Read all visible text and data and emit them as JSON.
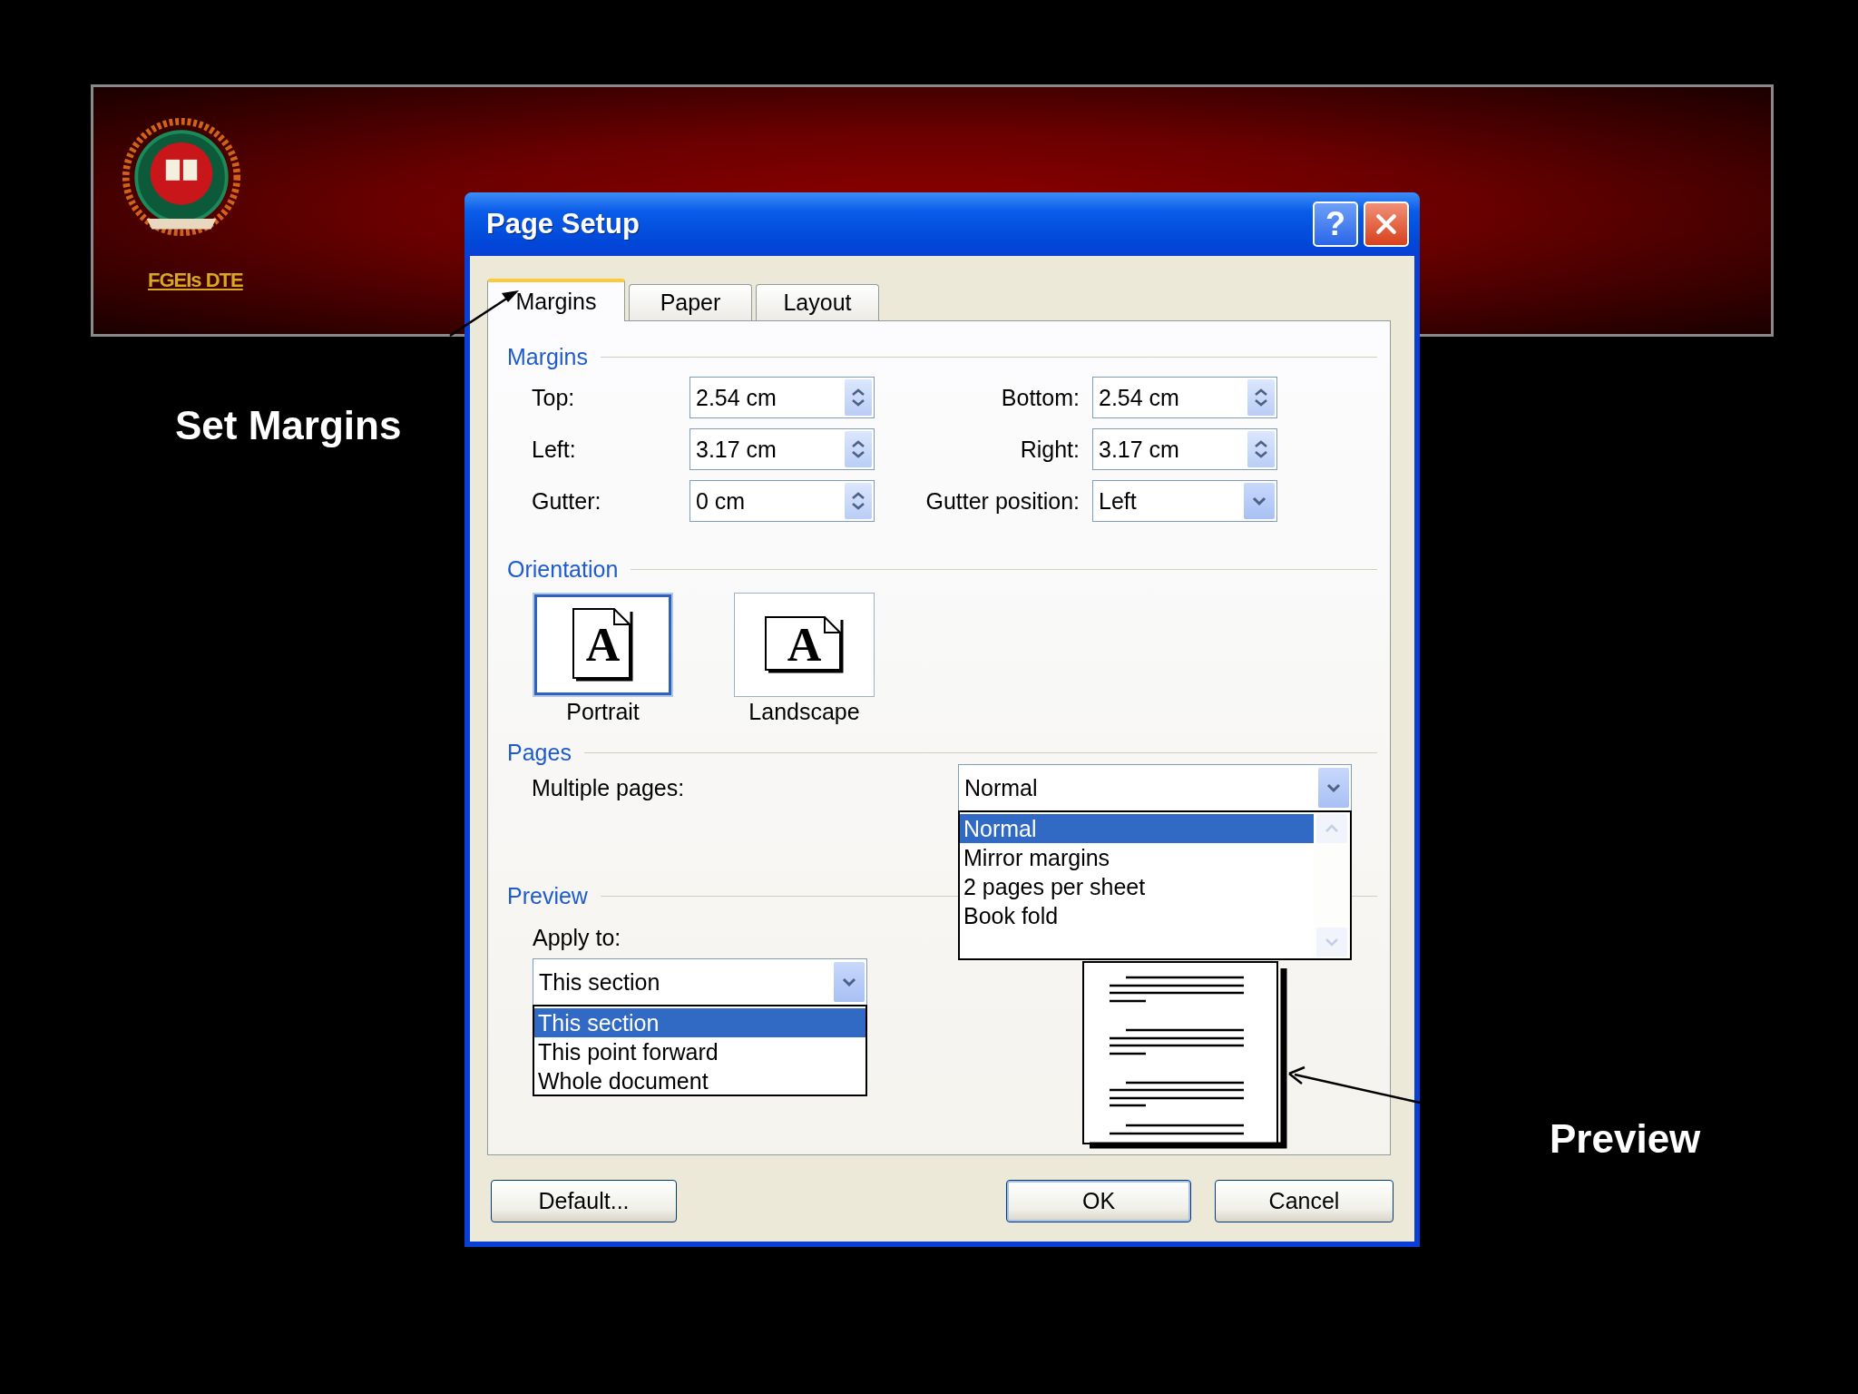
{
  "slide": {
    "logo_text": "FGEIs DTE",
    "callouts": [
      {
        "kind": "margins",
        "text": "Set Margins"
      },
      {
        "kind": "preview",
        "text": "Preview"
      }
    ]
  },
  "dialog": {
    "title": "Page Setup",
    "title_buttons": [
      {
        "kind": "help",
        "label": "?"
      },
      {
        "kind": "close"
      }
    ],
    "tabs": [
      {
        "label": "Margins",
        "selected": true
      },
      {
        "label": "Paper",
        "selected": false
      },
      {
        "label": "Layout",
        "selected": false
      }
    ],
    "margins": {
      "heading": "Margins",
      "fields": [
        {
          "label": "Top:",
          "value": "2.54 cm",
          "kind": "spin"
        },
        {
          "label": "Bottom:",
          "value": "2.54 cm",
          "kind": "spin"
        },
        {
          "label": "Left:",
          "value": "3.17 cm",
          "kind": "spin"
        },
        {
          "label": "Right:",
          "value": "3.17 cm",
          "kind": "spin"
        },
        {
          "label": "Gutter:",
          "value": "0 cm",
          "kind": "spin"
        },
        {
          "label": "Gutter position:",
          "value": "Left",
          "kind": "dropdown"
        }
      ]
    },
    "orientation": {
      "heading": "Orientation",
      "options": [
        {
          "label": "Portrait",
          "icon_letter": "A",
          "kind": "portrait",
          "selected": true
        },
        {
          "label": "Landscape",
          "icon_letter": "A",
          "kind": "landscape",
          "selected": false
        }
      ]
    },
    "pages": {
      "heading": "Pages",
      "label": "Multiple pages:",
      "value": "Normal",
      "expanded": true,
      "options": [
        {
          "label": "Normal",
          "selected": true
        },
        {
          "label": "Mirror margins",
          "selected": false
        },
        {
          "label": "2 pages per sheet",
          "selected": false
        },
        {
          "label": "Book fold",
          "selected": false
        }
      ]
    },
    "preview": {
      "heading": "Preview",
      "apply_label": "Apply to:",
      "value": "This section",
      "expanded": true,
      "options": [
        {
          "label": "This section",
          "selected": true
        },
        {
          "label": "This point forward",
          "selected": false
        },
        {
          "label": "Whole document",
          "selected": false
        }
      ]
    },
    "buttons": [
      {
        "label": "Default...",
        "default": false
      },
      {
        "label": "OK",
        "default": true
      },
      {
        "label": "Cancel",
        "default": false
      }
    ]
  }
}
